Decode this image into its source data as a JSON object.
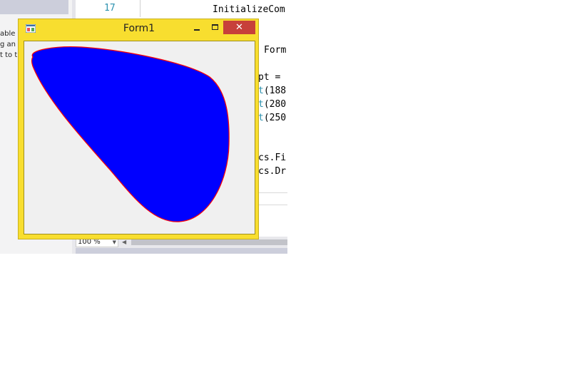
{
  "left_panel": {
    "lines": [
      "able",
      "g an",
      "t to t"
    ]
  },
  "editor": {
    "line_number": "17",
    "code_lines": [
      {
        "text": "InitializeCom",
        "highlight": ""
      },
      {
        "text": "Form",
        "highlight": ""
      },
      {
        "text": "pt =",
        "highlight": ""
      },
      {
        "pre": "t",
        "text": "(188",
        "highlight": "t"
      },
      {
        "pre": "t",
        "text": "(280",
        "highlight": "t"
      },
      {
        "pre": "t",
        "text": "(250",
        "highlight": "t"
      },
      {
        "text": "cs.Fi",
        "highlight": ""
      },
      {
        "text": "cs.Dr",
        "highlight": ""
      }
    ],
    "zoom_level": "100 %"
  },
  "form": {
    "title": "Form1",
    "close_glyph": "✕",
    "shape_fill": "#0000ff",
    "shape_stroke": "#ff0000",
    "icons": {
      "app": "app-icon",
      "minimize": "minimize-icon",
      "maximize": "maximize-icon",
      "close": "close-icon"
    }
  }
}
